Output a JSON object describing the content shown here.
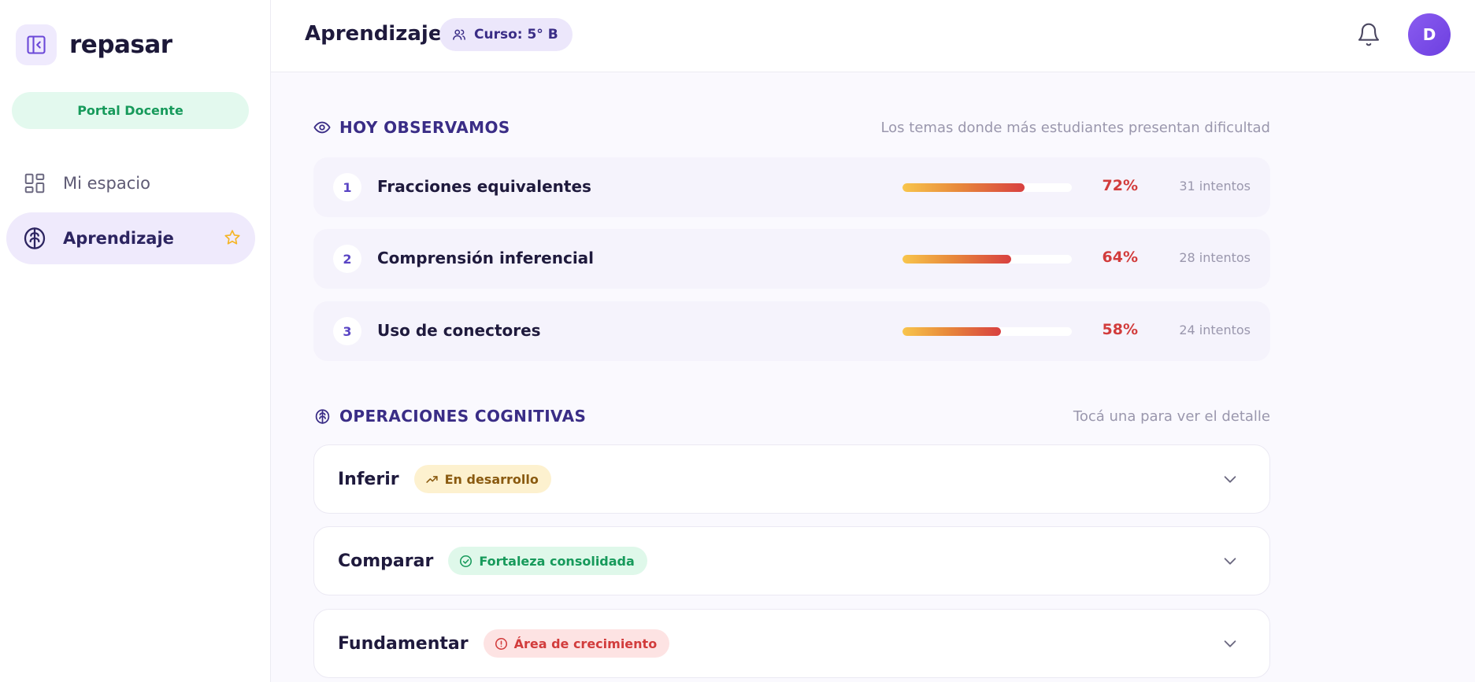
{
  "sidebar": {
    "brand_name": "repasar",
    "portal_label": "Portal Docente",
    "items": [
      {
        "label": "Mi espacio",
        "icon": "grid-icon",
        "active": false
      },
      {
        "label": "Aprendizaje",
        "icon": "brain-icon",
        "active": true,
        "starred": true
      }
    ]
  },
  "header": {
    "title": "Aprendizaje",
    "course_label": "Curso: 5° B",
    "avatar_initial": "D"
  },
  "observations": {
    "title": "HOY OBSERVAMOS",
    "hint": "Los temas donde más estudiantes presentan dificultad",
    "topics": [
      {
        "rank": "1",
        "name": "Fracciones equivalentes",
        "percent": 72,
        "percent_label": "72%",
        "attempts": "31 intentos"
      },
      {
        "rank": "2",
        "name": "Comprensión inferencial",
        "percent": 64,
        "percent_label": "64%",
        "attempts": "28 intentos"
      },
      {
        "rank": "3",
        "name": "Uso de conectores",
        "percent": 58,
        "percent_label": "58%",
        "attempts": "24 intentos"
      }
    ]
  },
  "operations": {
    "title": "OPERACIONES COGNITIVAS",
    "hint": "Tocá una para ver el detalle",
    "items": [
      {
        "name": "Inferir",
        "status": "En desarrollo",
        "status_icon": "trending-up-icon",
        "status_color": "#8a5a10"
      },
      {
        "name": "Comparar",
        "status": "Fortaleza consolidada",
        "status_icon": "check-circle-icon",
        "status_color": "#179a5b"
      },
      {
        "name": "Fundamentar",
        "status": "Área de crecimiento",
        "status_icon": "alert-circle-icon",
        "status_color": "#d23c3c"
      }
    ]
  },
  "colors": {
    "accent": "#3a2d86",
    "brand_purple": "#7c4fe8",
    "success": "#179a5b",
    "warning": "#8a5a10",
    "danger": "#d23c3c"
  }
}
